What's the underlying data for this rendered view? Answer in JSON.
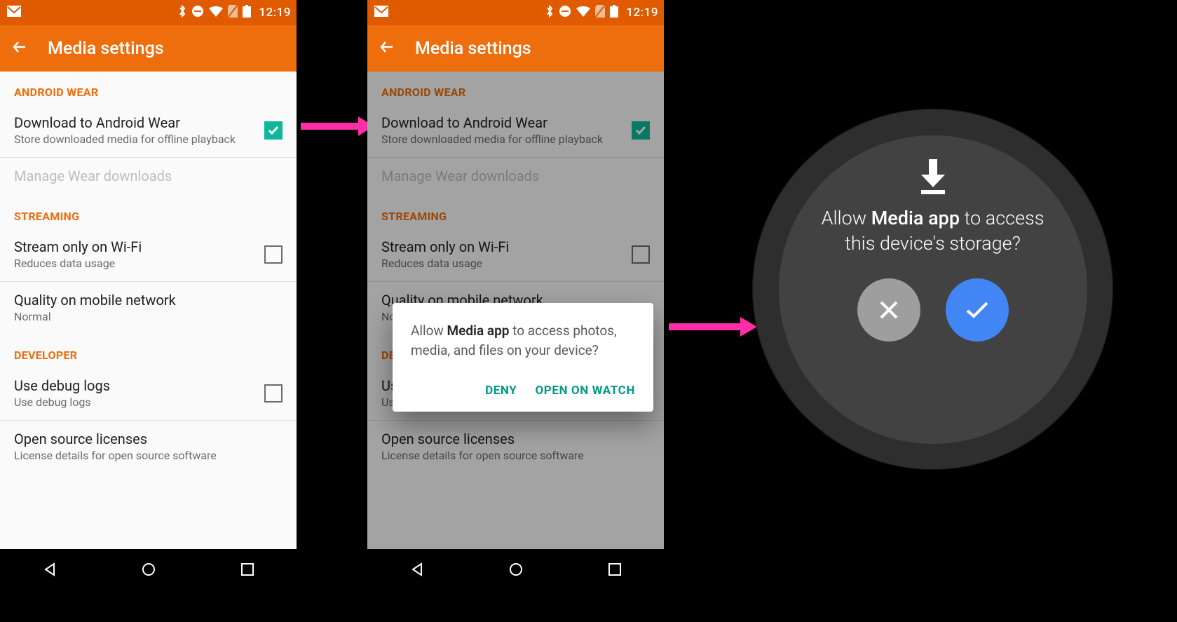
{
  "statusbar": {
    "time": "12:19"
  },
  "appbar": {
    "title": "Media settings"
  },
  "sections": {
    "wear": {
      "header": "ANDROID WEAR",
      "download": {
        "title": "Download to Android Wear",
        "sub": "Store downloaded media for offline playback"
      },
      "manage": {
        "title": "Manage Wear downloads"
      }
    },
    "streaming": {
      "header": "STREAMING",
      "wifi": {
        "title": "Stream only on Wi-Fi",
        "sub": "Reduces data usage"
      },
      "quality": {
        "title": "Quality on mobile network",
        "sub": "Normal"
      }
    },
    "developer": {
      "header": "DEVELOPER",
      "logs": {
        "title": "Use debug logs",
        "sub": "Use debug logs"
      },
      "oss": {
        "title": "Open source licenses",
        "sub": "License details for open source software"
      }
    }
  },
  "dialog": {
    "pre": "Allow ",
    "app": "Media app",
    "post": " to access photos, media, and files on your device?",
    "deny": "DENY",
    "open": "OPEN ON WATCH"
  },
  "watch": {
    "pre": "Allow ",
    "app": "Media app",
    "post": "  to access this device's storage?"
  }
}
